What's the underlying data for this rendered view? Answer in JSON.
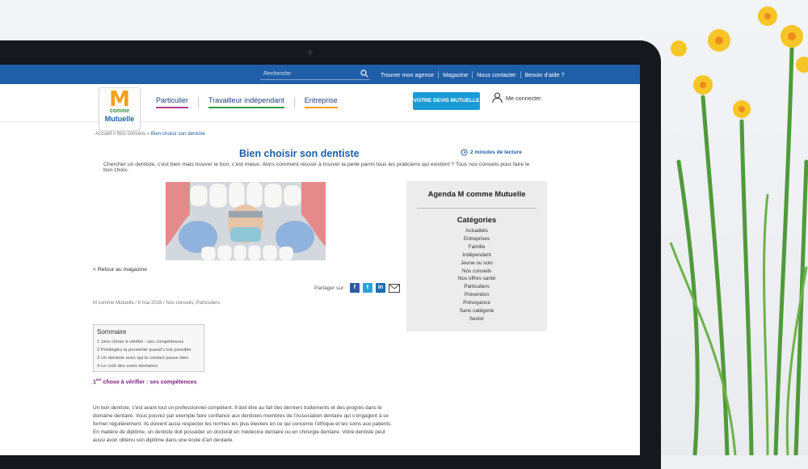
{
  "topbar": {
    "search_placeholder": "Recherche",
    "links": [
      "Trouver mon agence",
      "Magazine",
      "Nous contacter",
      "Besoin d'aide ?"
    ]
  },
  "logo": {
    "letter": "M",
    "line1": "comme",
    "line2": "Mutuelle"
  },
  "nav": {
    "particulier": "Particulier",
    "travailleur": "Travailleur indépendant",
    "entreprise": "Entreprise",
    "devis": "VOTRE DEVIS MUTUELLE",
    "connect": "Me connecter"
  },
  "breadcrumb": {
    "home": "Accueil",
    "sep": " » ",
    "section": "Nos conseils",
    "current": "Bien choisir son dentiste"
  },
  "article": {
    "title": "Bien choisir son dentiste",
    "read_time": "2 minutes de lecture",
    "intro": "Chercher un dentiste, c’est bien mais trouver le bon, c’est mieux. Alors comment réussir à trouver la perle parmi tous les praticiens qui existent ? Tous nos conseils pour faire le bon choix.",
    "back_link": "< Retour au magazine",
    "share_label": "Partager sur :",
    "meta": "M comme Mutuelle / 9 mai 2016 / Nos conseils, Particuliers",
    "toc_title": "Sommaire",
    "toc": [
      "1 1ère chose à vérifier : ses compétences",
      "2 Privilégiez la proximité quand c’est possible",
      "3 Un dentiste avec qui le contact passe bien",
      "4 Le coût des soins dentaires"
    ],
    "section_heading": {
      "num": "1",
      "sup": "ère",
      "text": " chose à vérifier : ses compétences"
    },
    "body_lines": [
      "Un bon dentiste, c’est avant tout un professionnel compétent. Il doit être au fait des derniers traitements et des progrès dans le",
      "domaine dentaire. Vous pouvez par exemple faire confiance aux dentistes membres de l’Association dentaire qui s’engagent à se",
      "former régulièrement. Ils doivent aussi respecter les normes les plus élevées en ce qui concerne l’éthique et les soins aux patients.",
      "En matière de diplôme, un dentiste doit posséder un doctorat en médecine dentaire ou en chirurgie dentaire. Votre dentiste peut",
      "aussi avoir obtenu son diplôme dans une école d’art dentaire."
    ]
  },
  "sidebar": {
    "agenda": "Agenda M comme Mutuelle",
    "categories_title": "Catégories",
    "categories": [
      "Actualités",
      "Entreprises",
      "Famille",
      "Indépendant",
      "Jeune ou solo",
      "Nos conseils",
      "Nos offres santé",
      "Particuliers",
      "Prévention",
      "Prévoyance",
      "Sans catégorie",
      "Senior"
    ]
  },
  "colors": {
    "brand_blue": "#1f5ea8",
    "devis_blue": "#1a9bd7",
    "heading_purple": "#7a1f84"
  }
}
